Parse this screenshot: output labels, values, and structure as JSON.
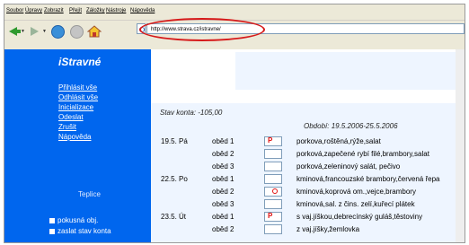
{
  "menu": [
    "Soubor",
    "Úpravy",
    "Zobrazit",
    "Přejít",
    "Záložky",
    "Nástroje",
    "Nápověda"
  ],
  "address": {
    "url": "http://www.strava.cz/istravne/"
  },
  "sidebar": {
    "title": "iStravné",
    "links": [
      "Přihlásit vše",
      "Odhlásit vše",
      "Inicializace",
      "Odeslat",
      "Zrušit",
      "Nápověda"
    ],
    "city": "Teplice",
    "checkboxes": [
      "pokusná obj.",
      "zaslat stav konta"
    ]
  },
  "main": {
    "balance": "Stav konta:  -105,00",
    "period": "Období: 19.5.2006-25.5.2006"
  },
  "rows": [
    {
      "date": "19.5. Pá",
      "meal": "oběd 1",
      "mark": "P",
      "desc": "porkova,roštěná,rýže,salat"
    },
    {
      "date": "",
      "meal": "oběd 2",
      "mark": "",
      "desc": "porková,zapečené rybí filé,brambory,salat"
    },
    {
      "date": "",
      "meal": "oběd 3",
      "mark": "",
      "desc": "porková,zeleninový salát, pečivo"
    },
    {
      "date": "22.5. Po",
      "meal": "oběd 1",
      "mark": "",
      "desc": "kminová,francouzské brambory,červená řepa"
    },
    {
      "date": "",
      "meal": "oběd 2",
      "mark": "o",
      "desc": "kminová,koprová om.,vejce,brambory"
    },
    {
      "date": "",
      "meal": "oběd 3",
      "mark": "",
      "desc": "kminová,sal. z čins. zelí,kuřecí plátek"
    },
    {
      "date": "23.5. Út",
      "meal": "oběd 1",
      "mark": "P",
      "desc": "s vaj.jíškou,debrecínský guláš,těstoviny"
    },
    {
      "date": "",
      "meal": "oběd 2",
      "mark": "",
      "desc": "z vaj.jíšky,žemlovka"
    }
  ]
}
